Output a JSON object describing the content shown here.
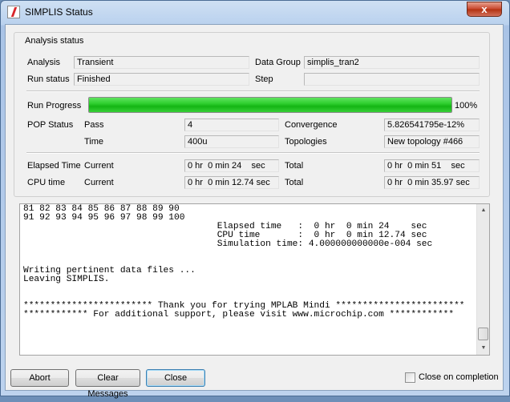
{
  "window": {
    "title": "SIMPLIS Status",
    "close_glyph": "x"
  },
  "analysis_status": {
    "group_title": "Analysis status",
    "analysis_label": "Analysis",
    "analysis_value": "Transient",
    "data_group_label": "Data Group",
    "data_group_value": "simplis_tran2",
    "run_status_label": "Run status",
    "run_status_value": "Finished",
    "step_label": "Step",
    "step_value": "",
    "run_progress_label": "Run Progress",
    "run_progress_value": 100,
    "run_progress_text": "100%",
    "pop_status_label": "POP Status",
    "pass_label": "Pass",
    "pass_value": "4",
    "convergence_label": "Convergence",
    "convergence_value": "5.826541795e-12%",
    "time_label": "Time",
    "time_value": "400u",
    "topologies_label": "Topologies",
    "topologies_value": "New topology #466",
    "elapsed_time_label": "Elapsed Time",
    "elapsed_current_label": "Current",
    "elapsed_current_value": "0 hr  0 min 24    sec",
    "elapsed_total_label": "Total",
    "elapsed_total_value": "0 hr  0 min 51    sec",
    "cpu_time_label": "CPU time",
    "cpu_current_label": "Current",
    "cpu_current_value": "0 hr  0 min 12.74 sec",
    "cpu_total_label": "Total",
    "cpu_total_value": "0 hr  0 min 35.97 sec"
  },
  "console": {
    "lines": [
      "81 82 83 84 85 86 87 88 89 90",
      "91 92 93 94 95 96 97 98 99 100",
      "                                    Elapsed time   :  0 hr  0 min 24    sec",
      "                                    CPU time       :  0 hr  0 min 12.74 sec",
      "                                    Simulation time: 4.000000000000e-004 sec",
      "",
      "",
      "Writing pertinent data files ...",
      "Leaving SIMPLIS.",
      "",
      "",
      "************************ Thank you for trying MPLAB Mindi ************************",
      "************ For additional support, please visit www.microchip.com ************"
    ]
  },
  "buttons": {
    "abort": "Abort",
    "clear_messages": "Clear Messages",
    "close": "Close"
  },
  "close_on_completion": {
    "label": "Close on completion",
    "checked": false
  },
  "colors": {
    "progress": "#22c322",
    "title_close": "#c7442a"
  }
}
